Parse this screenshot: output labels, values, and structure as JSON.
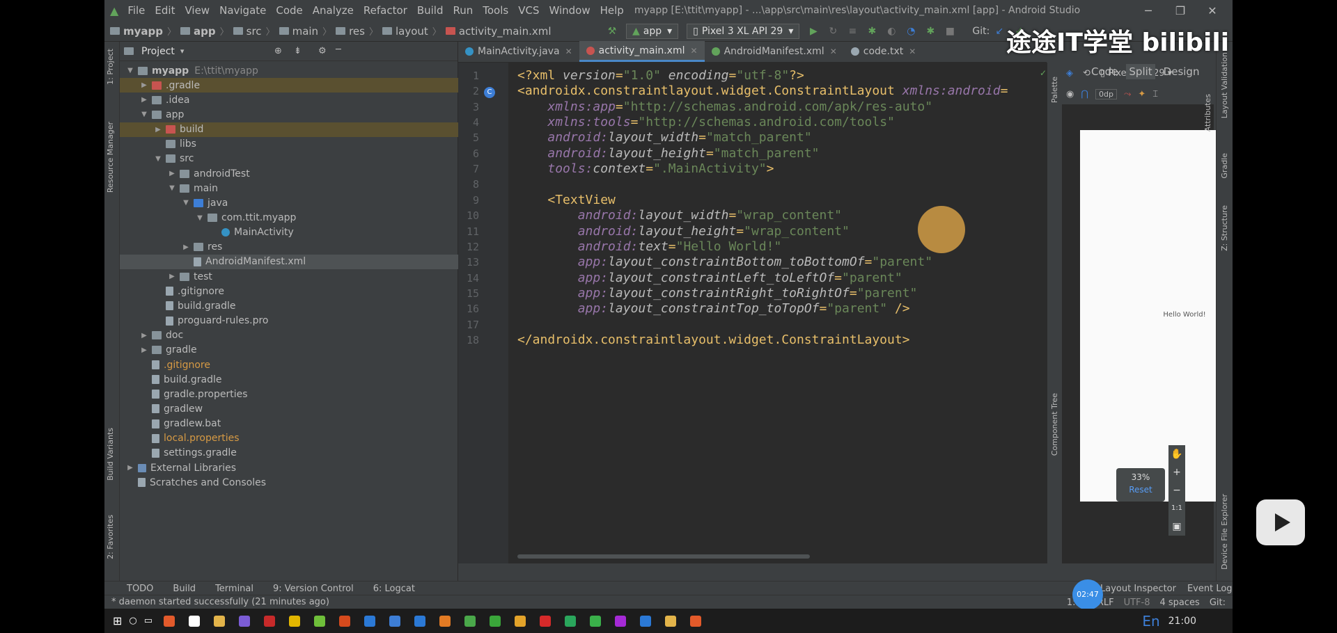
{
  "window": {
    "title": "myapp [E:\\ttit\\myapp] - ...\\app\\src\\main\\res\\layout\\activity_main.xml [app] - Android Studio",
    "menu": [
      "File",
      "Edit",
      "View",
      "Navigate",
      "Code",
      "Analyze",
      "Refactor",
      "Build",
      "Run",
      "Tools",
      "VCS",
      "Window",
      "Help"
    ]
  },
  "breadcrumb": [
    "myapp",
    "app",
    "src",
    "main",
    "res",
    "layout",
    "activity_main.xml"
  ],
  "toolbar": {
    "run_config": "app",
    "device": "Pixel 3 XL API 29",
    "git_label": "Git:"
  },
  "project_panel": {
    "title": "Project",
    "tree": [
      {
        "label": "myapp",
        "extra": "E:\\ttit\\myapp",
        "depth": 0,
        "arrow": "▼",
        "icon": "folder"
      },
      {
        "label": ".gradle",
        "depth": 1,
        "arrow": "▶",
        "icon": "red",
        "style": "ign"
      },
      {
        "label": ".idea",
        "depth": 1,
        "arrow": "▶",
        "icon": "folder"
      },
      {
        "label": "app",
        "depth": 1,
        "arrow": "▼",
        "icon": "folder"
      },
      {
        "label": "build",
        "depth": 2,
        "arrow": "▶",
        "icon": "red",
        "style": "ign"
      },
      {
        "label": "libs",
        "depth": 2,
        "arrow": "",
        "icon": "folder"
      },
      {
        "label": "src",
        "depth": 2,
        "arrow": "▼",
        "icon": "folder"
      },
      {
        "label": "androidTest",
        "depth": 3,
        "arrow": "▶",
        "icon": "folder"
      },
      {
        "label": "main",
        "depth": 3,
        "arrow": "▼",
        "icon": "folder"
      },
      {
        "label": "java",
        "depth": 4,
        "arrow": "▼",
        "icon": "blue"
      },
      {
        "label": "com.ttit.myapp",
        "depth": 5,
        "arrow": "▼",
        "icon": "folder"
      },
      {
        "label": "MainActivity",
        "depth": 6,
        "arrow": "",
        "icon": "cls"
      },
      {
        "label": "res",
        "depth": 4,
        "arrow": "▶",
        "icon": "folder"
      },
      {
        "label": "AndroidManifest.xml",
        "depth": 4,
        "arrow": "",
        "icon": "file",
        "style": "selfile"
      },
      {
        "label": "test",
        "depth": 3,
        "arrow": "▶",
        "icon": "folder"
      },
      {
        "label": ".gitignore",
        "depth": 2,
        "arrow": "",
        "icon": "file"
      },
      {
        "label": "build.gradle",
        "depth": 2,
        "arrow": "",
        "icon": "file"
      },
      {
        "label": "proguard-rules.pro",
        "depth": 2,
        "arrow": "",
        "icon": "file"
      },
      {
        "label": "doc",
        "depth": 1,
        "arrow": "▶",
        "icon": "folder"
      },
      {
        "label": "gradle",
        "depth": 1,
        "arrow": "▶",
        "icon": "folder"
      },
      {
        "label": ".gitignore",
        "depth": 1,
        "arrow": "",
        "icon": "file",
        "style": "orange"
      },
      {
        "label": "build.gradle",
        "depth": 1,
        "arrow": "",
        "icon": "file"
      },
      {
        "label": "gradle.properties",
        "depth": 1,
        "arrow": "",
        "icon": "file"
      },
      {
        "label": "gradlew",
        "depth": 1,
        "arrow": "",
        "icon": "file"
      },
      {
        "label": "gradlew.bat",
        "depth": 1,
        "arrow": "",
        "icon": "file"
      },
      {
        "label": "local.properties",
        "depth": 1,
        "arrow": "",
        "icon": "file",
        "style": "orange"
      },
      {
        "label": "settings.gradle",
        "depth": 1,
        "arrow": "",
        "icon": "file"
      },
      {
        "label": "External Libraries",
        "depth": 0,
        "arrow": "▶",
        "icon": "lib"
      },
      {
        "label": "Scratches and Consoles",
        "depth": 0,
        "arrow": "",
        "icon": "file"
      }
    ]
  },
  "tabs": [
    {
      "label": "MainActivity.java",
      "color": "#3592c4",
      "active": false
    },
    {
      "label": "activity_main.xml",
      "color": "#c75450",
      "active": true
    },
    {
      "label": "AndroidManifest.xml",
      "color": "#62a35b",
      "active": false
    },
    {
      "label": "code.txt",
      "color": "#9aa7b0",
      "active": false
    }
  ],
  "editor": {
    "lines": [
      [
        [
          "pi",
          "<?xml "
        ],
        [
          "attrn",
          "version"
        ],
        [
          "punct",
          "="
        ],
        [
          "val",
          "\"1.0\" "
        ],
        [
          "attrn",
          "encoding"
        ],
        [
          "punct",
          "="
        ],
        [
          "val",
          "\"utf-8\""
        ],
        [
          "pi",
          "?>"
        ]
      ],
      [
        [
          "tag",
          "<androidx.constraintlayout.widget.ConstraintLayout "
        ],
        [
          "ns",
          "xmlns:android"
        ],
        [
          "punct",
          "="
        ]
      ],
      [
        [
          "attr",
          "    "
        ],
        [
          "ns",
          "xmlns:"
        ],
        [
          "ns",
          "app"
        ],
        [
          "punct",
          "="
        ],
        [
          "val",
          "\"http://schemas.android.com/apk/res-auto\""
        ]
      ],
      [
        [
          "attr",
          "    "
        ],
        [
          "ns",
          "xmlns:"
        ],
        [
          "ns",
          "tools"
        ],
        [
          "punct",
          "="
        ],
        [
          "val",
          "\"http://schemas.android.com/tools\""
        ]
      ],
      [
        [
          "attr",
          "    "
        ],
        [
          "ns",
          "android:"
        ],
        [
          "attrn",
          "layout_width"
        ],
        [
          "punct",
          "="
        ],
        [
          "val",
          "\"match_parent\""
        ]
      ],
      [
        [
          "attr",
          "    "
        ],
        [
          "ns",
          "android:"
        ],
        [
          "attrn",
          "layout_height"
        ],
        [
          "punct",
          "="
        ],
        [
          "val",
          "\"match_parent\""
        ]
      ],
      [
        [
          "attr",
          "    "
        ],
        [
          "ns",
          "tools:"
        ],
        [
          "attrn",
          "context"
        ],
        [
          "punct",
          "="
        ],
        [
          "val",
          "\".MainActivity\""
        ],
        [
          "tag",
          ">"
        ]
      ],
      [
        [
          "attr",
          ""
        ]
      ],
      [
        [
          "attr",
          "    "
        ],
        [
          "tag",
          "<TextView"
        ]
      ],
      [
        [
          "attr",
          "        "
        ],
        [
          "ns",
          "android:"
        ],
        [
          "attrn",
          "layout_width"
        ],
        [
          "punct",
          "="
        ],
        [
          "val",
          "\"wrap_content\""
        ]
      ],
      [
        [
          "attr",
          "        "
        ],
        [
          "ns",
          "android:"
        ],
        [
          "attrn",
          "layout_height"
        ],
        [
          "punct",
          "="
        ],
        [
          "val",
          "\"wrap_content\""
        ]
      ],
      [
        [
          "attr",
          "        "
        ],
        [
          "ns",
          "android:"
        ],
        [
          "attrn",
          "text"
        ],
        [
          "punct",
          "="
        ],
        [
          "val",
          "\"Hello World!\""
        ]
      ],
      [
        [
          "attr",
          "        "
        ],
        [
          "ns",
          "app:"
        ],
        [
          "attrn",
          "layout_constraintBottom_toBottomOf"
        ],
        [
          "punct",
          "="
        ],
        [
          "val",
          "\"parent\""
        ]
      ],
      [
        [
          "attr",
          "        "
        ],
        [
          "ns",
          "app:"
        ],
        [
          "attrn",
          "layout_constraintLeft_toLeftOf"
        ],
        [
          "punct",
          "="
        ],
        [
          "val",
          "\"parent\""
        ]
      ],
      [
        [
          "attr",
          "        "
        ],
        [
          "ns",
          "app:"
        ],
        [
          "attrn",
          "layout_constraintRight_toRightOf"
        ],
        [
          "punct",
          "="
        ],
        [
          "val",
          "\"parent\""
        ]
      ],
      [
        [
          "attr",
          "        "
        ],
        [
          "ns",
          "app:"
        ],
        [
          "attrn",
          "layout_constraintTop_toTopOf"
        ],
        [
          "punct",
          "="
        ],
        [
          "val",
          "\"parent\" "
        ],
        [
          "tag",
          "/>"
        ]
      ],
      [
        [
          "attr",
          ""
        ]
      ],
      [
        [
          "tag",
          "</androidx.constraintlayout.widget.ConstraintLayout>"
        ]
      ]
    ]
  },
  "design": {
    "modes": [
      "Code",
      "Split",
      "Design"
    ],
    "device": "Pixel",
    "api": "29",
    "margin": "0dp",
    "preview_text": "Hello World!",
    "zoom": "33%",
    "reset": "Reset",
    "ratio": "1:1"
  },
  "side_tabs": {
    "left": [
      "1: Project",
      "Resource Manager",
      "Build Variants",
      "2: Favorites"
    ],
    "right": [
      "Layout Validation",
      "Attributes",
      "Gradle",
      "Z: Structure",
      "Device File Explorer"
    ],
    "palette": "Palette",
    "component_tree": "Component Tree"
  },
  "bottom_tools": [
    "TODO",
    "Build",
    "Terminal",
    "9: Version Control",
    "6: Logcat"
  ],
  "bottom_right": [
    "Layout Inspector",
    "Event Log"
  ],
  "status": {
    "message": "* daemon started successfully (21 minutes ago)",
    "position": "1:1",
    "line_sep": "CRLF",
    "encoding": "UTF-8",
    "spaces": "4 spaces",
    "git": "Git:"
  },
  "overlay": {
    "watermark": "途途IT学堂 bilibili",
    "timer": "02:47",
    "clock": "21:00",
    "ime": "En"
  }
}
